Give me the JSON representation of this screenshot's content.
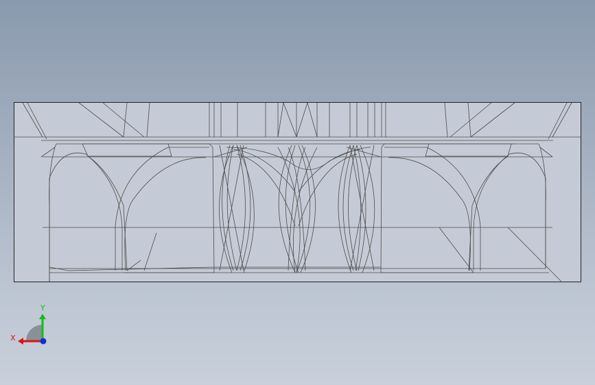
{
  "triad": {
    "x_label": "X",
    "y_label": "Y",
    "x_color": "#e01010",
    "y_color": "#10c010",
    "z_color": "#1030d0"
  },
  "model": {
    "view": "wireframe",
    "edge_color": "#4a4a4a",
    "face_color": "#c5cbd6",
    "border_color": "#222222"
  }
}
